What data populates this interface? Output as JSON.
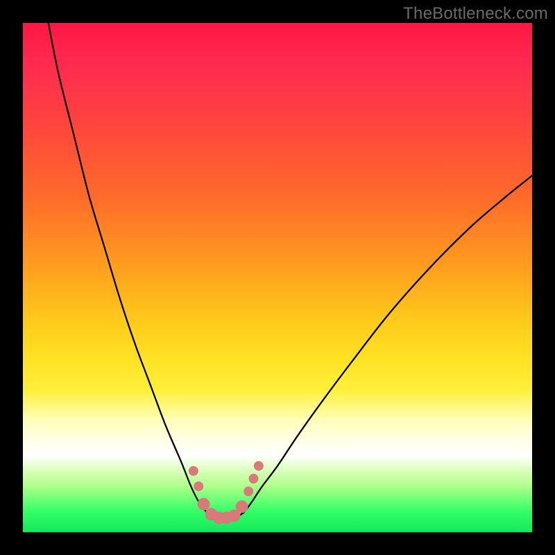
{
  "watermark": "TheBottleneck.com",
  "chart_data": {
    "type": "line",
    "title": "",
    "xlabel": "",
    "ylabel": "",
    "xlim": [
      0,
      100
    ],
    "ylim": [
      0,
      100
    ],
    "grid": false,
    "series": [
      {
        "name": "left-curve",
        "x": [
          5,
          7,
          10,
          13,
          16,
          19,
          22,
          25,
          28,
          31,
          33,
          34.5,
          36,
          37
        ],
        "values": [
          100,
          90,
          78,
          66,
          56,
          46,
          37,
          29,
          21,
          14,
          9,
          6,
          4,
          3
        ]
      },
      {
        "name": "right-curve",
        "x": [
          42,
          43.5,
          45,
          47,
          50,
          54,
          59,
          65,
          72,
          80,
          88,
          95,
          100
        ],
        "values": [
          3,
          4,
          6,
          9,
          13,
          19,
          26,
          34,
          43,
          52,
          60,
          66,
          70
        ]
      }
    ],
    "markers": {
      "name": "valley-markers",
      "color": "#d97a7a",
      "radius_small": 7,
      "radius_large": 9,
      "points": [
        {
          "x": 33.5,
          "y": 12,
          "r": "small"
        },
        {
          "x": 34.5,
          "y": 9,
          "r": "small"
        },
        {
          "x": 35.5,
          "y": 5.5,
          "r": "large"
        },
        {
          "x": 37,
          "y": 3.5,
          "r": "large"
        },
        {
          "x": 38.5,
          "y": 2.8,
          "r": "large"
        },
        {
          "x": 40,
          "y": 2.8,
          "r": "large"
        },
        {
          "x": 41.5,
          "y": 3.2,
          "r": "large"
        },
        {
          "x": 43,
          "y": 5,
          "r": "large"
        },
        {
          "x": 44.3,
          "y": 8,
          "r": "small"
        },
        {
          "x": 45.3,
          "y": 10.5,
          "r": "small"
        },
        {
          "x": 46.3,
          "y": 13,
          "r": "small"
        }
      ]
    },
    "gradient_stops": [
      {
        "pos": 0.0,
        "color": "#ff1744"
      },
      {
        "pos": 0.08,
        "color": "#ff2a4f"
      },
      {
        "pos": 0.18,
        "color": "#ff4040"
      },
      {
        "pos": 0.34,
        "color": "#ff6a2a"
      },
      {
        "pos": 0.47,
        "color": "#ff9a1f"
      },
      {
        "pos": 0.58,
        "color": "#ffc81a"
      },
      {
        "pos": 0.66,
        "color": "#ffe224"
      },
      {
        "pos": 0.72,
        "color": "#ffef3a"
      },
      {
        "pos": 0.78,
        "color": "#ffffb8"
      },
      {
        "pos": 0.82,
        "color": "#ffffe8"
      },
      {
        "pos": 0.85,
        "color": "#ffffff"
      },
      {
        "pos": 0.88,
        "color": "#d8ffb8"
      },
      {
        "pos": 0.91,
        "color": "#aeff8a"
      },
      {
        "pos": 0.96,
        "color": "#33ff66"
      },
      {
        "pos": 1.0,
        "color": "#12e85b"
      }
    ]
  }
}
